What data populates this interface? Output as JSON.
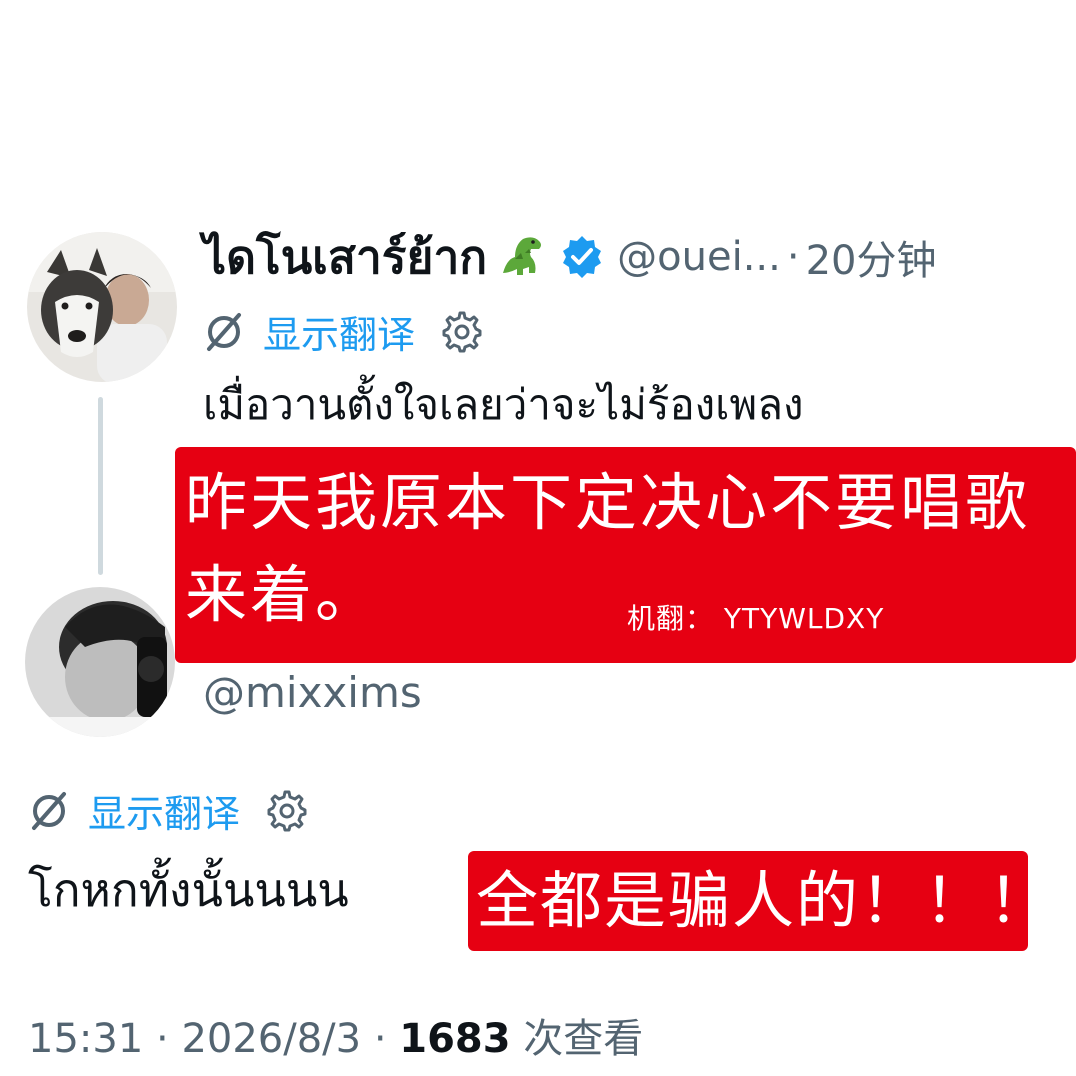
{
  "quoted_tweet": {
    "display_name": "ไดโนเสาร์ย้าก",
    "display_name_emoji": "t-rex-icon",
    "verified": true,
    "handle": "@ouei...",
    "separator": "·",
    "time_ago": "20分钟",
    "translate_label": "显示翻译",
    "text": "เมื่อวานตั้งใจเลยว่าจะไม่ร้องเพลง"
  },
  "annotation_top": {
    "text": "昨天我原本下定决心不要唱歌来着。",
    "credit": "机翻：  YTYWLDXY"
  },
  "reply_tweet": {
    "handle": "@mixxims",
    "translate_label": "显示翻译",
    "text": "โกหกทั้งนั้นนนน"
  },
  "annotation_bottom": {
    "text": "全都是骗人的！！！"
  },
  "footer": {
    "time": "15:31",
    "date": "2026/8/3",
    "separator": "·",
    "views_count": "1683",
    "views_label": "次查看"
  },
  "colors": {
    "link_blue": "#1d9bf0",
    "muted_gray": "#536471",
    "annotation_red": "#e60012",
    "thread_line": "#cfd9de"
  }
}
